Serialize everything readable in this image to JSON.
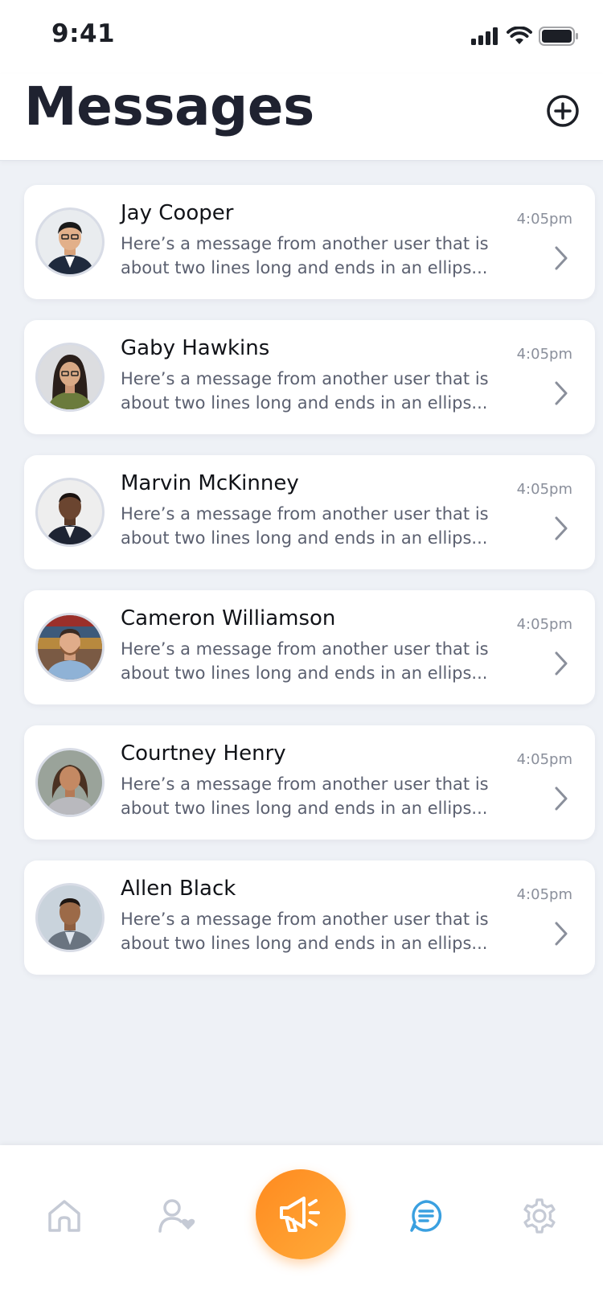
{
  "status_bar": {
    "time": "9:41"
  },
  "header": {
    "title": "Messages",
    "add_icon": "plus-circle-icon"
  },
  "colors": {
    "accent_orange": "#ff9a2a",
    "active_tab": "#3aa0e0",
    "inactive_tab": "#c5cad5",
    "background": "#eef1f6"
  },
  "conversations": [
    {
      "name": "Jay Cooper",
      "preview_line1": "Here’s a message from another user that is",
      "preview_line2": "about two lines long and ends in an ellips...",
      "time": "4:05pm"
    },
    {
      "name": "Gaby Hawkins",
      "preview_line1": "Here’s a message from another user that is",
      "preview_line2": "about two lines long and ends in an ellips...",
      "time": "4:05pm"
    },
    {
      "name": "Marvin McKinney",
      "preview_line1": "Here’s a message from another user that is",
      "preview_line2": "about two lines long and ends in an ellips...",
      "time": "4:05pm"
    },
    {
      "name": "Cameron Williamson",
      "preview_line1": "Here’s a message from another user that is",
      "preview_line2": "about two lines long and ends in an ellips...",
      "time": "4:05pm"
    },
    {
      "name": "Courtney Henry",
      "preview_line1": "Here’s a message from another user that is",
      "preview_line2": "about two lines long and ends in an ellips...",
      "time": "4:05pm"
    },
    {
      "name": "Allen Black",
      "preview_line1": "Here’s a message from another user that is",
      "preview_line2": "about two lines long and ends in an ellips...",
      "time": "4:05pm"
    }
  ],
  "tabbar": {
    "items": [
      {
        "icon": "home-icon",
        "active": false
      },
      {
        "icon": "user-heart-icon",
        "active": false
      },
      {
        "icon": "megaphone-icon",
        "active": false,
        "primary": true
      },
      {
        "icon": "chat-bubble-icon",
        "active": true
      },
      {
        "icon": "gear-icon",
        "active": false
      }
    ]
  }
}
